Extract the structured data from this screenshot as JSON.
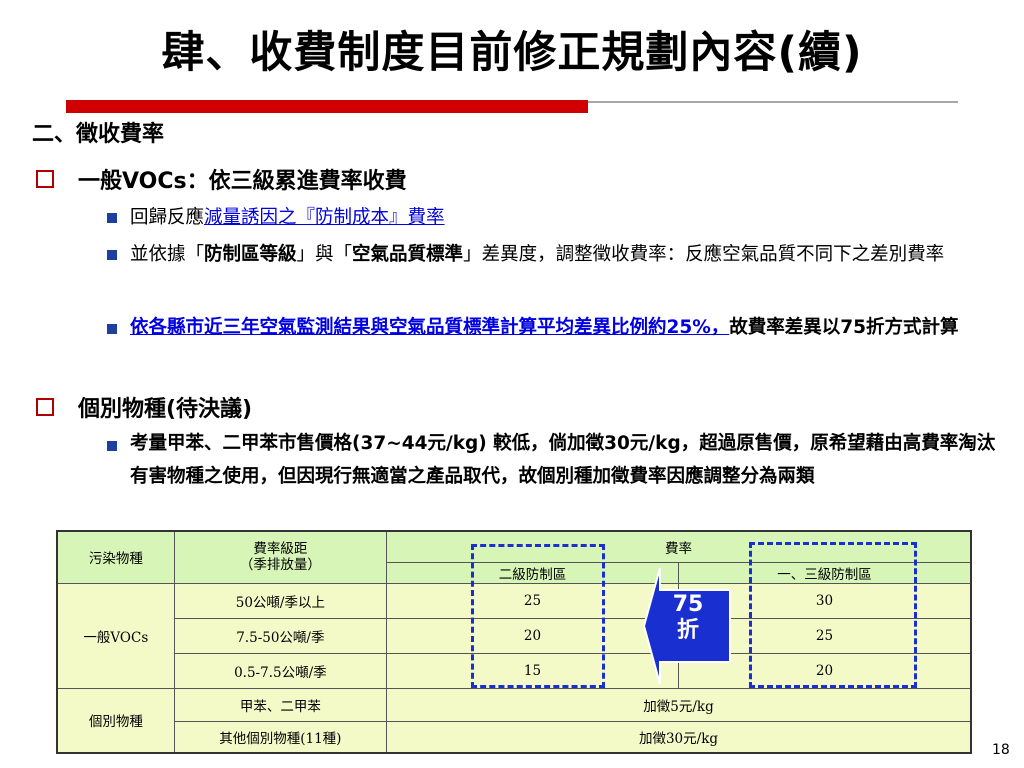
{
  "title": "肆、收費制度目前修正規劃內容(續)",
  "section": "二、徵收費率",
  "items": [
    {
      "heading": "一般VOCs：依三級累進費率收費",
      "bullets": [
        {
          "pre": "回歸反應",
          "link": "減量誘因之『防制成本』費率"
        },
        {
          "pre": "並依據「",
          "b1": "防制區等級",
          "mid": "」與「",
          "b2": "空氣品質標準",
          "post": "」差異度，調整徵收費率：反應空氣品質不同下之差別費率"
        },
        {
          "link": "依各縣市近三年空氣監測結果與空氣品質標準計算平均差異比例約25%，",
          "post": "故費率差異以75折方式計算"
        }
      ]
    },
    {
      "heading": "個別物種(待決議)",
      "bullets": [
        {
          "text": "考量甲苯、二甲苯市售價格(37~44元/kg) 較低，倘加徵30元/kg，超過原售價，原希望藉由高費率淘汰有害物種之使用，但因現行無適當之產品取代，故個別種加徵費率因應調整分為兩類"
        }
      ]
    }
  ],
  "table": {
    "headers": {
      "pollutant": "污染物種",
      "bracket": "費率級距",
      "bracket_sub": "（季排放量）",
      "rate": "費率",
      "zone2": "二級防制區",
      "zone13": "一、三級防制區"
    },
    "voc_label": "一般VOCs",
    "voc_rows": [
      {
        "bracket": "50公噸/季以上",
        "zone2": "25",
        "zone13": "30"
      },
      {
        "bracket": "7.5-50公噸/季",
        "zone2": "20",
        "zone13": "25"
      },
      {
        "bracket": "0.5-7.5公噸/季",
        "zone2": "15",
        "zone13": "20"
      }
    ],
    "species_label": "個別物種",
    "species_rows": [
      {
        "bracket": "甲苯、二甲苯",
        "rate": "加徵5元/kg"
      },
      {
        "bracket": "其他個別物種(11種)",
        "rate": "加徵30元/kg"
      }
    ]
  },
  "callout": {
    "number": "75",
    "char": "折"
  },
  "page_number": "18",
  "colors": {
    "rule": "#d10000",
    "link": "#0000e0",
    "dash": "#1a2fcf",
    "table_bg": "#f3f9c7",
    "header_bg": "#d7f5b7"
  }
}
